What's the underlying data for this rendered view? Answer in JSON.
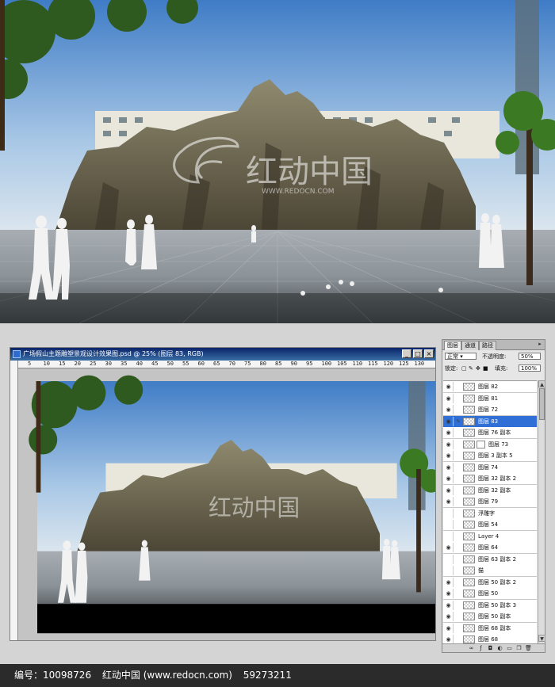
{
  "document": {
    "title": "广场假山主题雕塑景观设计效果图.psd @ 25% (图层 83, RGB)",
    "ruler_marks": [
      "5",
      "10",
      "15",
      "20",
      "25",
      "30",
      "35",
      "40",
      "45",
      "50",
      "55",
      "60",
      "65",
      "70",
      "75",
      "80",
      "85",
      "90",
      "95",
      "100",
      "105",
      "110",
      "115",
      "120",
      "125",
      "130"
    ]
  },
  "watermark": {
    "text": "红动中国",
    "url": "WWW.REDOCN.COM"
  },
  "layers_panel": {
    "tabs": [
      "图层",
      "通道",
      "路径"
    ],
    "blend_mode": "正常",
    "opacity_label": "不透明度:",
    "opacity_value": "50%",
    "lock_label": "锁定:",
    "fill_label": "填充:",
    "fill_value": "100%",
    "layers": [
      {
        "name": "图层 82",
        "visible": true,
        "selected": false
      },
      {
        "name": "图层 81",
        "visible": true,
        "selected": false
      },
      {
        "name": "图层 72",
        "visible": true,
        "selected": false
      },
      {
        "name": "图层 83",
        "visible": true,
        "selected": true
      },
      {
        "name": "图层 76 副本",
        "visible": true,
        "selected": false
      },
      {
        "name": "图层 73",
        "visible": true,
        "selected": false,
        "mask": true
      },
      {
        "name": "图层 3 副本 5",
        "visible": true,
        "selected": false
      },
      {
        "name": "图层 74",
        "visible": true,
        "selected": false
      },
      {
        "name": "图层 32 副本 2",
        "visible": true,
        "selected": false
      },
      {
        "name": "图层 32 副本",
        "visible": true,
        "selected": false
      },
      {
        "name": "图层 79",
        "visible": true,
        "selected": false
      },
      {
        "name": "浮雕字",
        "visible": false,
        "selected": false
      },
      {
        "name": "图层 54",
        "visible": false,
        "selected": false
      },
      {
        "name": "Layer 4",
        "visible": false,
        "selected": false
      },
      {
        "name": "图层 64",
        "visible": true,
        "selected": false
      },
      {
        "name": "图层 63 副本 2",
        "visible": false,
        "selected": false
      },
      {
        "name": "猫",
        "visible": false,
        "selected": false
      },
      {
        "name": "图层 50 副本 2",
        "visible": true,
        "selected": false
      },
      {
        "name": "图层 50",
        "visible": true,
        "selected": false
      },
      {
        "name": "图层 50 副本 3",
        "visible": true,
        "selected": false
      },
      {
        "name": "图层 50 副本",
        "visible": true,
        "selected": false
      },
      {
        "name": "图层 68 副本",
        "visible": true,
        "selected": false
      },
      {
        "name": "图层 68",
        "visible": true,
        "selected": false
      }
    ]
  },
  "footer": {
    "id_label": "编号：10098726",
    "site": "红动中国 (www.redocn.com)",
    "number": "59273211"
  }
}
